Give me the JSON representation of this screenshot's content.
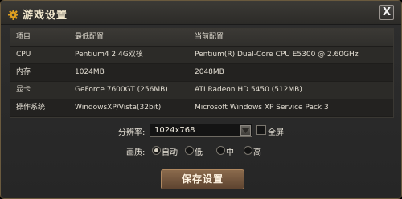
{
  "window": {
    "title": "游戏设置",
    "close_label": "X"
  },
  "table": {
    "headers": [
      "项目",
      "最低配置",
      "当前配置"
    ],
    "rows": [
      [
        "CPU",
        "Pentium4 2.4G双核",
        "Pentium(R) Dual-Core CPU E5300 @ 2.60GHz"
      ],
      [
        "内存",
        "1024MB",
        "2048MB"
      ],
      [
        "显卡",
        "GeForce 7600GT (256MB)",
        "ATI Radeon HD 5450 (512MB)"
      ],
      [
        "操作系统",
        "WindowsXP/Vista(32bit)",
        "Microsoft Windows XP Service Pack 3"
      ]
    ]
  },
  "resolution": {
    "label": "分辨率:",
    "value": "1024x768"
  },
  "fullscreen": {
    "label": "全屏",
    "checked": false
  },
  "quality": {
    "label": "画质:",
    "options": [
      "自动",
      "低",
      "中",
      "高"
    ],
    "selected": "自动"
  },
  "save_button": "保存设置",
  "colors": {
    "accent_gold": "#e0a020",
    "button_brown": "#7a5a3e"
  },
  "icons": {
    "title_icon": "gear-icon",
    "dropdown_icon": "chevron-down-icon"
  }
}
